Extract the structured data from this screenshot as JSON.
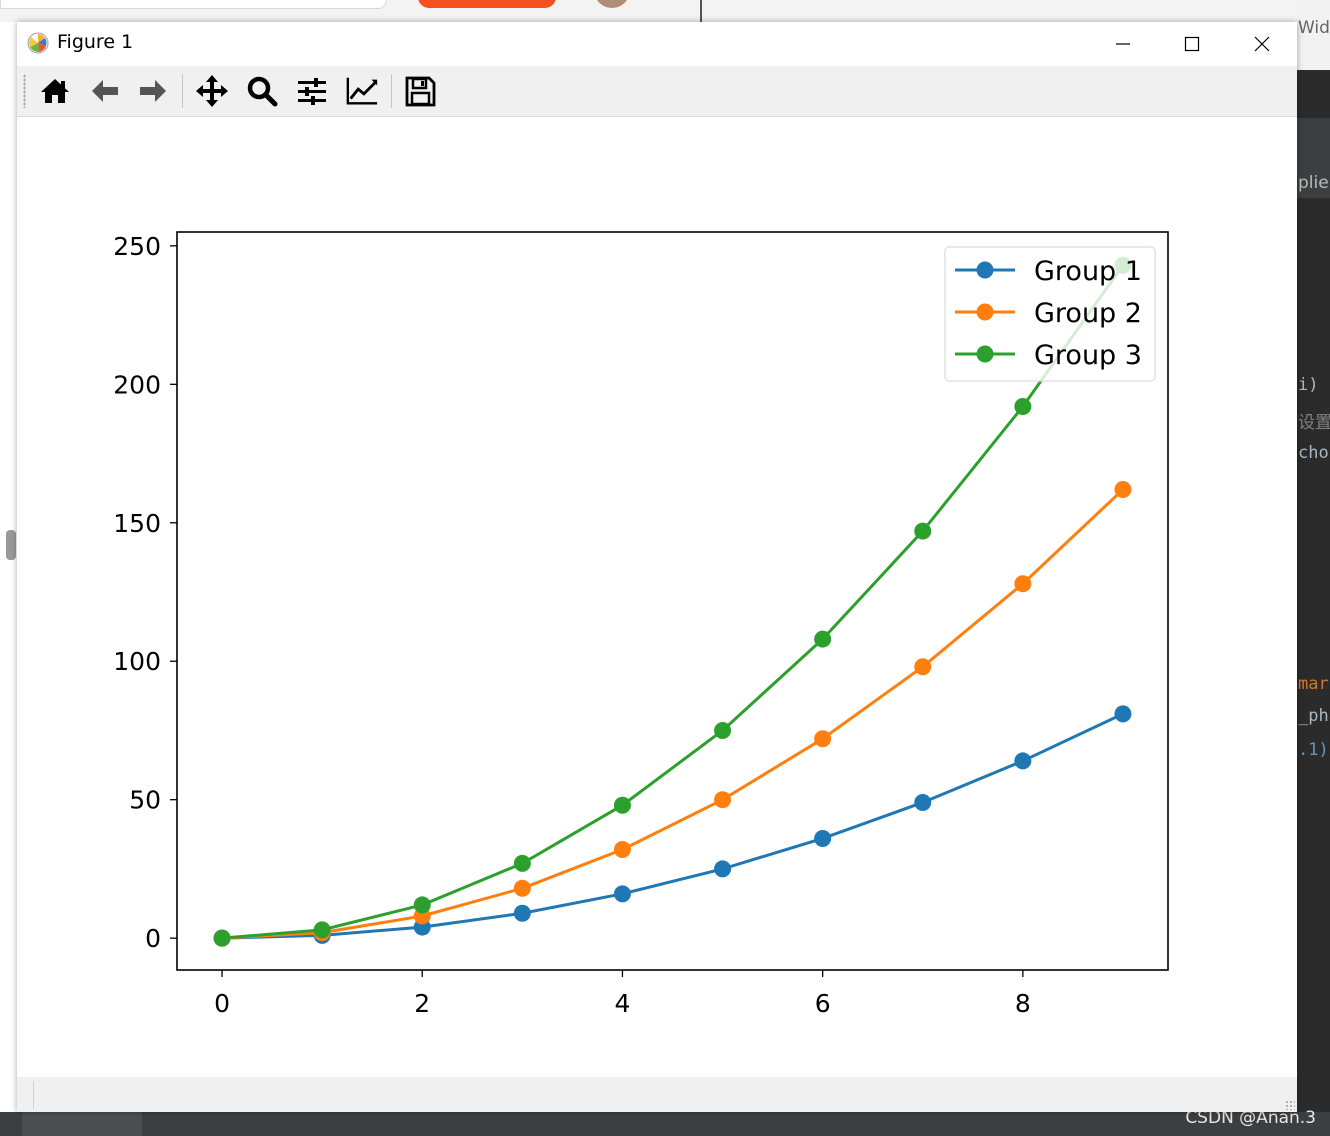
{
  "window": {
    "title": "Figure 1"
  },
  "toolbar": {
    "buttons": [
      {
        "name": "home-icon",
        "label": "Home"
      },
      {
        "name": "back-icon",
        "label": "Back"
      },
      {
        "name": "forward-icon",
        "label": "Forward"
      },
      {
        "name": "pan-icon",
        "label": "Pan"
      },
      {
        "name": "zoom-icon",
        "label": "Zoom"
      },
      {
        "name": "subplots-icon",
        "label": "Subplots"
      },
      {
        "name": "customize-icon",
        "label": "Customize"
      },
      {
        "name": "save-icon",
        "label": "Save"
      }
    ]
  },
  "background": {
    "code_fragments": [
      "Widg",
      "plien",
      "i)",
      "设置",
      "cho",
      "mar",
      "_pha",
      ".1)"
    ],
    "watermark": "CSDN @Anan.3"
  },
  "colors": {
    "series": [
      "#1f77b4",
      "#ff7f0e",
      "#2ca02c"
    ]
  },
  "chart_data": {
    "type": "line",
    "title": "",
    "xlabel": "",
    "ylabel": "",
    "xlim": [
      -0.45,
      9.45
    ],
    "ylim": [
      -11.5,
      255
    ],
    "xticks": [
      0,
      2,
      4,
      6,
      8
    ],
    "yticks": [
      0,
      50,
      100,
      150,
      200,
      250
    ],
    "grid": false,
    "legend_position": "top-right",
    "marker": "circle",
    "x": [
      0,
      1,
      2,
      3,
      4,
      5,
      6,
      7,
      8,
      9
    ],
    "series": [
      {
        "name": "Group 1",
        "values": [
          0,
          1,
          4,
          9,
          16,
          25,
          36,
          49,
          64,
          81
        ]
      },
      {
        "name": "Group 2",
        "values": [
          0,
          2,
          8,
          18,
          32,
          50,
          72,
          98,
          128,
          162
        ]
      },
      {
        "name": "Group 3",
        "values": [
          0,
          3,
          12,
          27,
          48,
          75,
          108,
          147,
          192,
          243
        ]
      }
    ]
  }
}
